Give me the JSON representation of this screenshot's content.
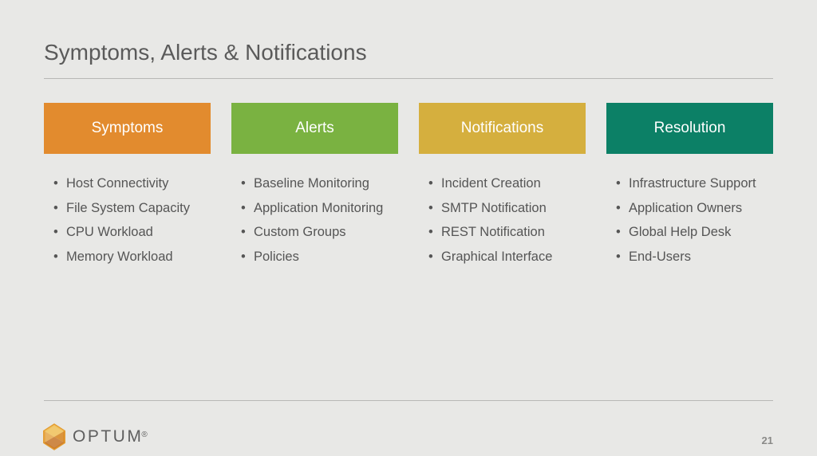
{
  "title": "Symptoms, Alerts & Notifications",
  "columns": [
    {
      "header": "Symptoms",
      "items": [
        "Host Connectivity",
        "File System Capacity",
        "CPU Workload",
        "Memory Workload"
      ]
    },
    {
      "header": "Alerts",
      "items": [
        "Baseline Monitoring",
        "Application Monitoring",
        "Custom Groups",
        "Policies"
      ]
    },
    {
      "header": "Notifications",
      "items": [
        "Incident Creation",
        "SMTP Notification",
        "REST Notification",
        "Graphical Interface"
      ]
    },
    {
      "header": "Resolution",
      "items": [
        "Infrastructure Support",
        "Application Owners",
        "Global Help Desk",
        "End-Users"
      ]
    }
  ],
  "logo_text": "OPTUM",
  "logo_registered": "®",
  "page_number": "21"
}
